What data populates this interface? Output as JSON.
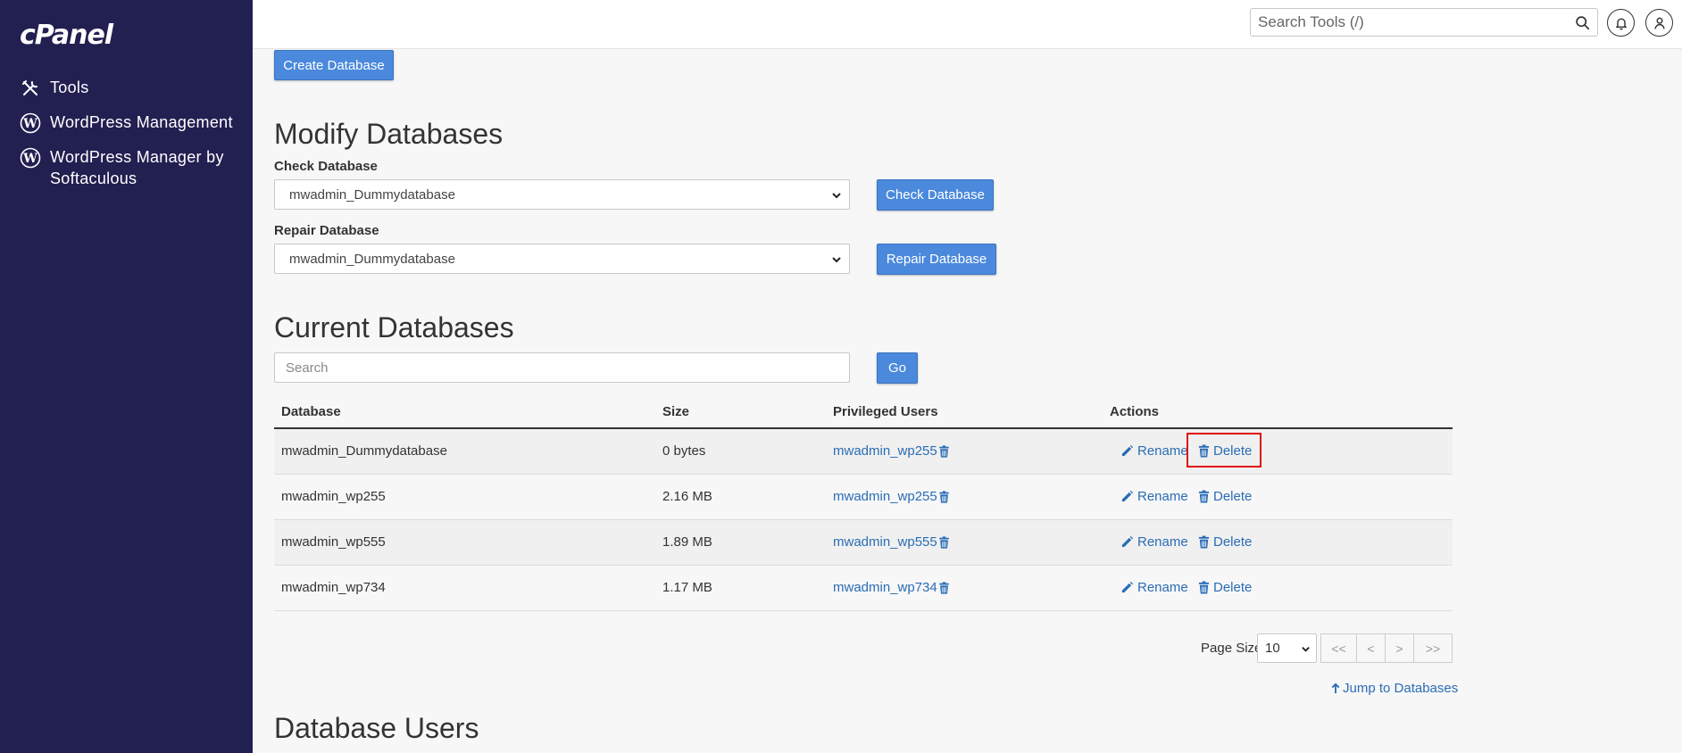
{
  "sidebar": {
    "logo": "cPanel",
    "items": [
      {
        "label": "Tools",
        "icon": "tools-icon"
      },
      {
        "label": "WordPress Management",
        "icon": "wordpress-icon"
      },
      {
        "label": "WordPress Manager by Softaculous",
        "icon": "wordpress-icon"
      }
    ]
  },
  "header": {
    "search_placeholder": "Search Tools (/)"
  },
  "create": {
    "button": "Create Database"
  },
  "modify": {
    "title": "Modify Databases",
    "check_label": "Check Database",
    "check_value": "mwadmin_Dummydatabase",
    "check_button": "Check Database",
    "repair_label": "Repair Database",
    "repair_value": "mwadmin_Dummydatabase",
    "repair_button": "Repair Database"
  },
  "current": {
    "title": "Current Databases",
    "search_placeholder": "Search",
    "go_button": "Go",
    "columns": [
      "Database",
      "Size",
      "Privileged Users",
      "Actions"
    ],
    "rows": [
      {
        "database": "mwadmin_Dummydatabase",
        "size": "0 bytes",
        "user": "mwadmin_wp255"
      },
      {
        "database": "mwadmin_wp255",
        "size": "2.16 MB",
        "user": "mwadmin_wp255"
      },
      {
        "database": "mwadmin_wp555",
        "size": "1.89 MB",
        "user": "mwadmin_wp555"
      },
      {
        "database": "mwadmin_wp734",
        "size": "1.17 MB",
        "user": "mwadmin_wp734"
      }
    ],
    "rename_label": "Rename",
    "delete_label": "Delete",
    "page_size_label": "Page Size",
    "page_size_value": "10",
    "pager": [
      "<<",
      "<",
      ">",
      ">>"
    ],
    "jump_label": "Jump to Databases"
  },
  "users": {
    "title": "Database Users"
  },
  "colors": {
    "sidebar": "#221f51",
    "primary": "#4a89dc",
    "link": "#2a6db5",
    "highlight": "#e01010"
  }
}
